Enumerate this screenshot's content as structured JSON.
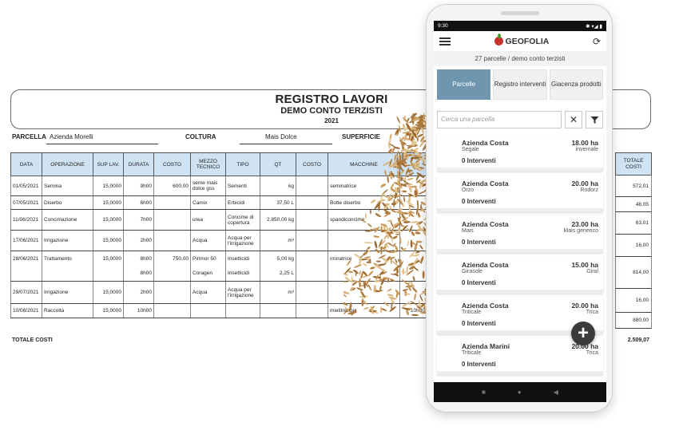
{
  "report": {
    "title": "REGISTRO LAVORI",
    "subtitle": "DEMO CONTO TERZISTI",
    "year": "2021",
    "parcella_label": "PARCELLA",
    "parcella_value": "Azienda Morelli",
    "coltura_label": "COLTURA",
    "coltura_value": "Mais Dolce",
    "superficie_label": "SUPERFICIE",
    "columns": [
      "DATA",
      "OPERAZIONE",
      "SUP LAV.",
      "DURATA",
      "COSTO",
      "MEZZO TECNICO",
      "TIPO",
      "QT",
      "COSTO",
      "MACCHINE"
    ],
    "totale_costi_header": "TOTALE COSTI",
    "rows": [
      {
        "data": "01/05/2021",
        "operazione": "Semina",
        "sup": "15,0000",
        "durata": "9h00",
        "costo": "600,00",
        "mezzo": "seme mais dolce gss",
        "tipo": "Sementi",
        "qt": "kg",
        "costo2": "",
        "macchine": "seminatrice",
        "totale": "572,01"
      },
      {
        "data": "07/05/2021",
        "operazione": "Diserbo",
        "sup": "15,0000",
        "durata": "6h00",
        "costo": "",
        "mezzo": "Camix",
        "tipo": "Erbicidi",
        "qt": "37,50 L",
        "costo2": "",
        "macchine": "Botte diserbo",
        "totale": "48,05"
      },
      {
        "data": "11/06/2021",
        "operazione": "Concimazione",
        "sup": "15,0000",
        "durata": "7h00",
        "costo": "",
        "mezzo": "urea",
        "tipo": "Concime di copertura",
        "qt": "2.850,00 kg",
        "costo2": "",
        "macchine": "spandiconcime",
        "totale": "63,01"
      },
      {
        "data": "17/06/2021",
        "operazione": "Irrigazione",
        "sup": "15,0000",
        "durata": "2h00",
        "costo": "",
        "mezzo": "Acqua",
        "tipo": "Acqua per l'irrigazione",
        "qt": "m³",
        "costo2": "",
        "macchine": "",
        "totale": "16,00"
      },
      {
        "data": "28/06/2021",
        "operazione": "Trattamento",
        "sup": "15,0000",
        "durata": "8h00",
        "costo": "750,00",
        "mezzo": "Pirimor 50",
        "tipo": "Insetticidi",
        "qt": "5,00 kg",
        "costo2": "",
        "macchine": "irroratrice",
        "totale": "814,00",
        "sub": {
          "durata": "8h00",
          "mezzo": "Coragen",
          "tipo": "Insetticidi",
          "qt": "2,25 L"
        }
      },
      {
        "data": "29/07/2021",
        "operazione": "Irrigazione",
        "sup": "15,0000",
        "durata": "2h00",
        "costo": "",
        "mezzo": "Acqua",
        "tipo": "Acqua per l'irrigazione",
        "qt": "m³",
        "costo2": "",
        "macchine": "",
        "totale": "16,00"
      },
      {
        "data": "10/08/2021",
        "operazione": "Raccolta",
        "sup": "15,0000",
        "durata": "10h00",
        "costo": "",
        "mezzo": "",
        "tipo": "",
        "qt": "",
        "costo2": "",
        "macchine": "mietitrebbia",
        "ore": "10h00",
        "totale": "880,00"
      }
    ],
    "totale_costi_label": "TOTALE COSTI",
    "totale_costi_value": "2.509,07"
  },
  "phone": {
    "status_time": "9:30",
    "status_icons": "✱ ▾◢ ▮",
    "app_name": "GEOFOLIA",
    "summary": "27 parcelle / demo conto terzisti",
    "tabs": [
      {
        "label": "Parcelle",
        "active": true
      },
      {
        "label": "Registro interventi",
        "active": false
      },
      {
        "label": "Giacenza prodotti",
        "active": false
      }
    ],
    "search_placeholder": "Cerca una parcella",
    "parcels": [
      {
        "name": "Azienda Costa",
        "crop": "Segale",
        "area": "18.00 ha",
        "variety": "invernale",
        "interventions": "0 Interventi"
      },
      {
        "name": "Azienda Costa",
        "crop": "Orzo",
        "area": "20.00 ha",
        "variety": "Rodorz",
        "interventions": "0 Interventi"
      },
      {
        "name": "Azienda Costa",
        "crop": "Mais",
        "area": "23.00 ha",
        "variety": "Mais generico",
        "interventions": "0 Interventi"
      },
      {
        "name": "Azienda Costa",
        "crop": "Girasole",
        "area": "15.00 ha",
        "variety": "Giral",
        "interventions": "0 Interventi"
      },
      {
        "name": "Azienda Costa",
        "crop": "Triticale",
        "area": "20.00 ha",
        "variety": "Trica",
        "interventions": "0 Interventi"
      },
      {
        "name": "Azienda Marini",
        "crop": "Triticale",
        "area": "20.00 ha",
        "variety": "Trica",
        "interventions": "0 Interventi"
      }
    ],
    "accent_color": "#6f96ae"
  }
}
